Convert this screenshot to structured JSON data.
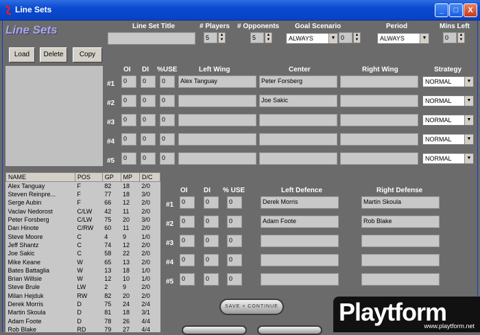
{
  "window": {
    "title": "Line Sets",
    "controls": [
      "_",
      "□",
      "X"
    ],
    "colors": {
      "titlebar": "#0a4bd0",
      "background": "#6b6b6b",
      "close": "#c6391a"
    }
  },
  "header": {
    "logo": "Line Sets",
    "line_set_title_label": "Line Set Title",
    "line_set_title_value": "",
    "players_label": "# Players",
    "players_value": "5",
    "opponents_label": "# Opponents",
    "opponents_value": "5",
    "goal_scenario_label": "Goal Scenario",
    "goal_scenario_value": "ALWAYS",
    "goal_scenario_num": "0",
    "period_label": "Period",
    "period_value": "ALWAYS",
    "mins_left_label": "Mins Left",
    "mins_left_value": "0"
  },
  "toolbar": {
    "load": "Load",
    "delete": "Delete",
    "copy": "Copy"
  },
  "forwards": {
    "headers": {
      "oi": "OI",
      "di": "DI",
      "use": "%USE",
      "lw": "Left Wing",
      "c": "Center",
      "rw": "Right Wing",
      "strategy": "Strategy"
    },
    "rows": [
      {
        "label": "#1",
        "oi": "0",
        "di": "0",
        "use": "0",
        "lw": "Alex Tanguay",
        "c": "Peter Forsberg",
        "rw": "",
        "strategy": "NORMAL"
      },
      {
        "label": "#2",
        "oi": "0",
        "di": "0",
        "use": "0",
        "lw": "",
        "c": "Joe Sakic",
        "rw": "",
        "strategy": "NORMAL"
      },
      {
        "label": "#3",
        "oi": "0",
        "di": "0",
        "use": "0",
        "lw": "",
        "c": "",
        "rw": "",
        "strategy": "NORMAL"
      },
      {
        "label": "#4",
        "oi": "0",
        "di": "0",
        "use": "0",
        "lw": "",
        "c": "",
        "rw": "",
        "strategy": "NORMAL"
      },
      {
        "label": "#5",
        "oi": "0",
        "di": "0",
        "use": "0",
        "lw": "",
        "c": "",
        "rw": "",
        "strategy": "NORMAL"
      }
    ]
  },
  "defence": {
    "headers": {
      "oi": "OI",
      "di": "DI",
      "use": "% USE",
      "ld": "Left Defence",
      "rd": "Right Defense"
    },
    "rows": [
      {
        "label": "#1",
        "oi": "0",
        "di": "0",
        "use": "0",
        "ld": "Derek Morris",
        "rd": "Martin Skoula"
      },
      {
        "label": "#2",
        "oi": "0",
        "di": "0",
        "use": "0",
        "ld": "Adam Foote",
        "rd": "Rob Blake"
      },
      {
        "label": "#3",
        "oi": "0",
        "di": "0",
        "use": "0",
        "ld": "",
        "rd": ""
      },
      {
        "label": "#4",
        "oi": "0",
        "di": "0",
        "use": "0",
        "ld": "",
        "rd": ""
      },
      {
        "label": "#5",
        "oi": "0",
        "di": "0",
        "use": "0",
        "ld": "",
        "rd": ""
      }
    ]
  },
  "players": {
    "columns": [
      "NAME",
      "POS",
      "GP",
      "MP",
      "D/C"
    ],
    "rows": [
      [
        "Alex Tanguay",
        "F",
        "82",
        "18",
        "2/0"
      ],
      [
        "Steven Reinpre...",
        "F",
        "77",
        "18",
        "3/0"
      ],
      [
        "Serge Aubin",
        "F",
        "66",
        "12",
        "2/0"
      ],
      [
        "Vaclav Nedorost",
        "C/LW",
        "42",
        "11",
        "2/0"
      ],
      [
        "Peter Forsberg",
        "C/LW",
        "75",
        "20",
        "3/0"
      ],
      [
        "Dan Hinote",
        "C/RW",
        "60",
        "11",
        "2/0"
      ],
      [
        "Steve Moore",
        "C",
        "4",
        "9",
        "1/0"
      ],
      [
        "Jeff Shantz",
        "C",
        "74",
        "12",
        "2/0"
      ],
      [
        "Joe Sakic",
        "C",
        "58",
        "22",
        "2/0"
      ],
      [
        "Mike Keane",
        "W",
        "65",
        "13",
        "2/0"
      ],
      [
        "Bates Battaglia",
        "W",
        "13",
        "18",
        "1/0"
      ],
      [
        "Brian Willsie",
        "W",
        "12",
        "10",
        "1/0"
      ],
      [
        "Steve Brule",
        "LW",
        "2",
        "9",
        "2/0"
      ],
      [
        "Milan Hejduk",
        "RW",
        "82",
        "20",
        "2/0"
      ],
      [
        "Derek Morris",
        "D",
        "75",
        "24",
        "2/4"
      ],
      [
        "Martin Skoula",
        "D",
        "81",
        "18",
        "3/1"
      ],
      [
        "Adam Foote",
        "D",
        "78",
        "26",
        "4/4"
      ],
      [
        "Rob Blake",
        "RD",
        "79",
        "27",
        "4/4"
      ]
    ]
  },
  "save_continue": "SAVE + CONTINUE",
  "watermark": {
    "brand": "Playtform",
    "url": "www.playtform.net"
  }
}
